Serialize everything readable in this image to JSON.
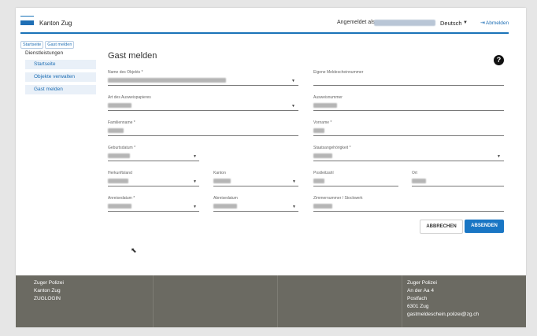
{
  "header": {
    "brand": "Kanton Zug",
    "logged_in_label": "Angemeldet als",
    "language": "Deutsch",
    "logout": "Abmelden"
  },
  "breadcrumbs": [
    "Startseite",
    "Gast melden"
  ],
  "sidebar": {
    "title": "Dienstleistungen",
    "items": [
      {
        "label": "Startseite"
      },
      {
        "label": "Objekte verwalten"
      },
      {
        "label": "Gast melden"
      }
    ]
  },
  "form": {
    "title": "Gast melden",
    "fields": {
      "objekt": {
        "label": "Name des Objekts *"
      },
      "meldeschein": {
        "label": "Eigene Meldescheinnummer"
      },
      "ausweisart": {
        "label": "Art des Ausweispapieres"
      },
      "ausweisnummer": {
        "label": "Ausweisnummer"
      },
      "familienname": {
        "label": "Familienname *"
      },
      "vorname": {
        "label": "Vorname *"
      },
      "geburtsdatum": {
        "label": "Geburtsdatum *"
      },
      "staatsangehoerigkeit": {
        "label": "Staatsangehörigkeit *"
      },
      "herkunftsland": {
        "label": "Herkunftsland"
      },
      "kanton": {
        "label": "Kanton"
      },
      "postleitzahl": {
        "label": "Postleitzahl"
      },
      "ort": {
        "label": "Ort"
      },
      "anreisedatum": {
        "label": "Anreisedatum *"
      },
      "abreisedatum": {
        "label": "Abreisedatum"
      },
      "zimmer": {
        "label": "Zimmernummer / Stockwerk"
      }
    },
    "cancel": "ABBRECHEN",
    "submit": "ABSENDEN"
  },
  "footer": {
    "left": [
      "Zuger Polizei",
      "Kanton Zug",
      "ZUGLOGIN"
    ],
    "right": [
      "Zuger Polizei",
      "An der Aa 4",
      "Postfach",
      "6301 Zug",
      "gastmeldeschein.polizei@zg.ch"
    ]
  },
  "colors": {
    "accent": "#1a73b8",
    "footer_bg": "#6b6a62"
  }
}
